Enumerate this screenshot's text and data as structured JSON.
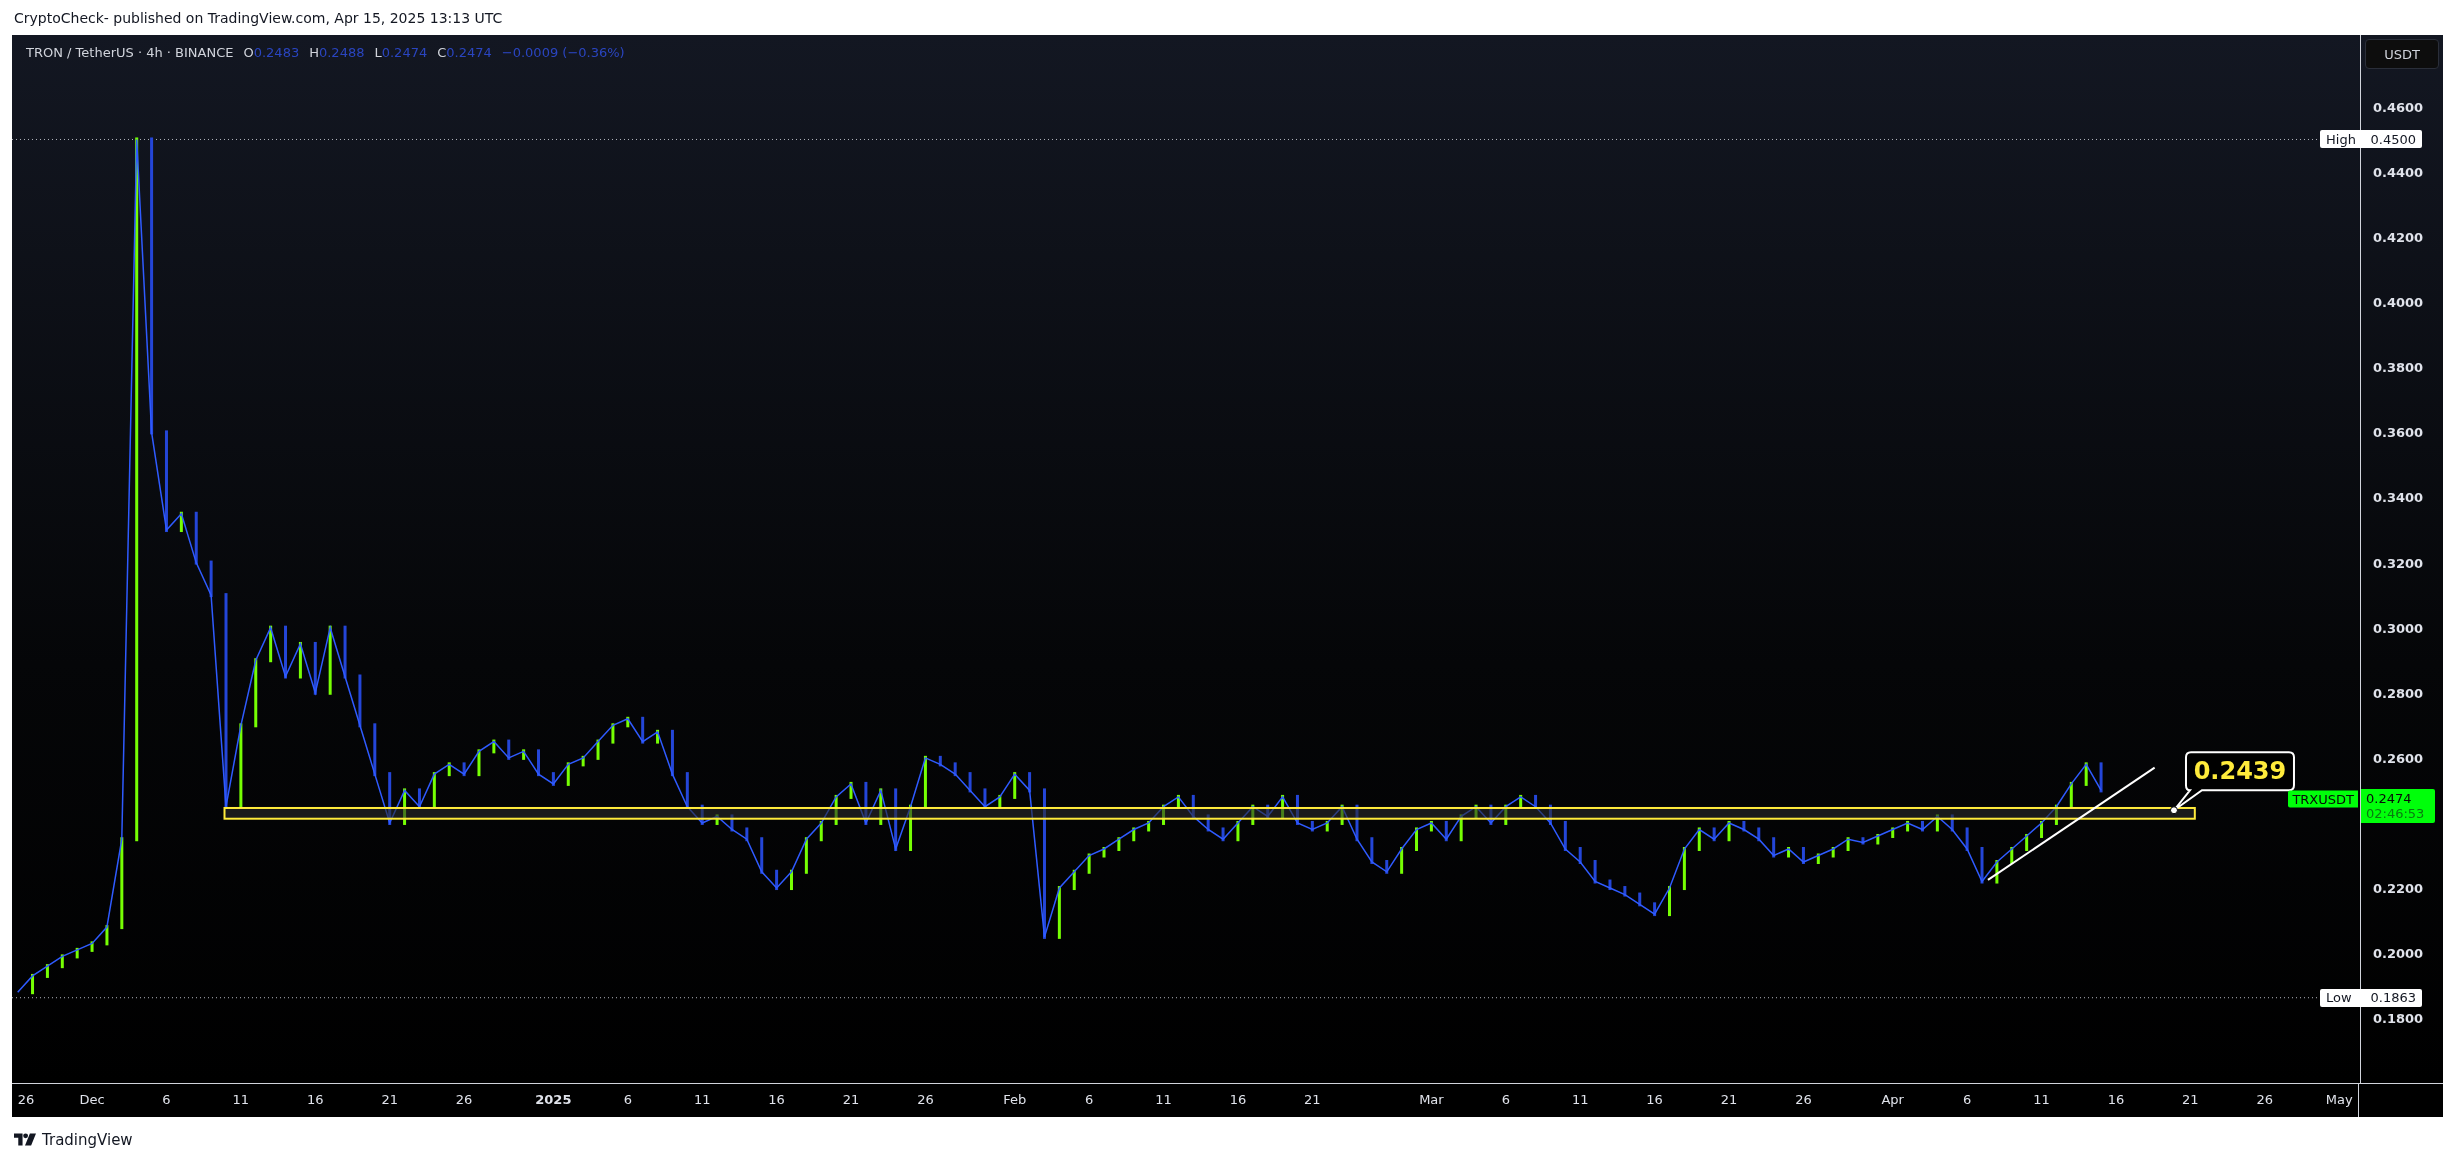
{
  "header": {
    "text": "CryptoCheck- published on TradingView.com, Apr 15, 2025 13:13 UTC"
  },
  "legend": {
    "symbol": "TRON / TetherUS · 4h · BINANCE",
    "fields": [
      {
        "label": "O",
        "value": "0.2483"
      },
      {
        "label": "H",
        "value": "0.2488"
      },
      {
        "label": "L",
        "value": "0.2474"
      },
      {
        "label": "C",
        "value": "0.2474"
      }
    ],
    "change": "−0.0009 (−0.36%)"
  },
  "currency_button": "USDT",
  "chart": {
    "price_axis": [
      "0.4600",
      "0.4400",
      "0.4200",
      "0.4000",
      "0.3800",
      "0.3600",
      "0.3400",
      "0.3200",
      "0.3000",
      "0.2800",
      "0.2600",
      "0.2200",
      "0.2000",
      "0.1800"
    ],
    "time_axis": [
      {
        "label": "26",
        "kind": "day"
      },
      {
        "label": "Dec",
        "kind": "month"
      },
      {
        "label": "6",
        "kind": "day"
      },
      {
        "label": "11",
        "kind": "day"
      },
      {
        "label": "16",
        "kind": "day"
      },
      {
        "label": "21",
        "kind": "day"
      },
      {
        "label": "26",
        "kind": "day"
      },
      {
        "label": "2025",
        "kind": "year"
      },
      {
        "label": "6",
        "kind": "day"
      },
      {
        "label": "11",
        "kind": "day"
      },
      {
        "label": "16",
        "kind": "day"
      },
      {
        "label": "21",
        "kind": "day"
      },
      {
        "label": "26",
        "kind": "day"
      },
      {
        "label": "Feb",
        "kind": "month"
      },
      {
        "label": "6",
        "kind": "day"
      },
      {
        "label": "11",
        "kind": "day"
      },
      {
        "label": "16",
        "kind": "day"
      },
      {
        "label": "21",
        "kind": "day"
      },
      {
        "label": "Mar",
        "kind": "month"
      },
      {
        "label": "6",
        "kind": "day"
      },
      {
        "label": "11",
        "kind": "day"
      },
      {
        "label": "16",
        "kind": "day"
      },
      {
        "label": "21",
        "kind": "day"
      },
      {
        "label": "26",
        "kind": "day"
      },
      {
        "label": "Apr",
        "kind": "month"
      },
      {
        "label": "6",
        "kind": "day"
      },
      {
        "label": "11",
        "kind": "day"
      },
      {
        "label": "16",
        "kind": "day"
      },
      {
        "label": "21",
        "kind": "day"
      },
      {
        "label": "26",
        "kind": "day"
      },
      {
        "label": "May",
        "kind": "month"
      }
    ],
    "high_marker": {
      "label": "High",
      "value": "0.4500"
    },
    "low_marker": {
      "label": "Low",
      "value": "0.1863"
    },
    "callout": "0.2439",
    "price_tag": {
      "symbol": "TRXUSDT",
      "price": "0.2474",
      "countdown": "02:46:53"
    }
  },
  "footer": {
    "brand": "TradingView"
  }
}
